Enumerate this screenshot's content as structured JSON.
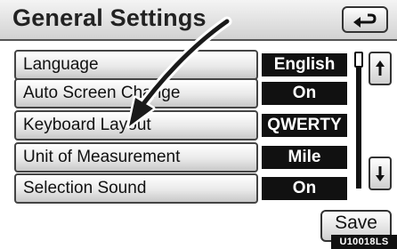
{
  "header": {
    "title": "General Settings",
    "back_icon": "return-arrow-icon"
  },
  "settings": [
    {
      "label": "Language",
      "value": "English"
    },
    {
      "label": "Auto Screen Change",
      "value": "On"
    },
    {
      "label": "Keyboard Layout",
      "value": "QWERTY"
    },
    {
      "label": "Unit of Measurement",
      "value": "Mile"
    },
    {
      "label": "Selection Sound",
      "value": "On"
    }
  ],
  "scroll": {
    "up_icon": "scroll-up-icon",
    "down_icon": "scroll-down-icon"
  },
  "footer": {
    "save_label": "Save",
    "reference_code": "U10018LS"
  },
  "annotation": {
    "icon": "pointer-arrow-icon",
    "target": "Keyboard Layout"
  }
}
